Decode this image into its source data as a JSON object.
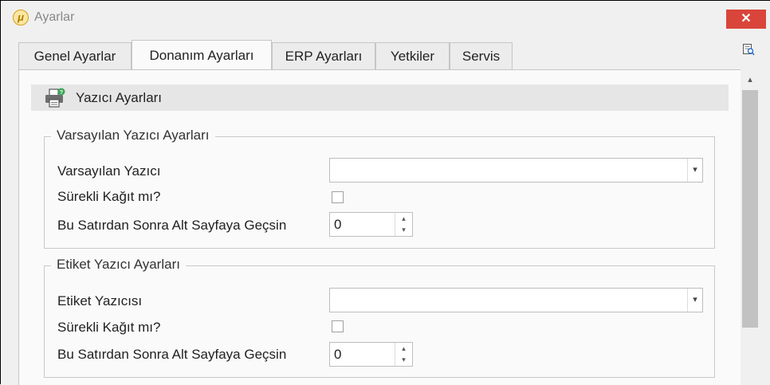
{
  "window": {
    "title": "Ayarlar",
    "app_icon_glyph": "μ",
    "close_glyph": "✕",
    "close_color": "#d9453b"
  },
  "tabs": [
    {
      "label": "Genel Ayarlar",
      "active": false
    },
    {
      "label": "Donanım Ayarları",
      "active": true
    },
    {
      "label": "ERP Ayarları",
      "active": false
    },
    {
      "label": "Yetkiler",
      "active": false
    },
    {
      "label": "Servis",
      "active": false
    }
  ],
  "section": {
    "title": "Yazıcı Ayarları",
    "icon": "printer-icon"
  },
  "default_printer_group": {
    "legend": "Varsayılan Yazıcı Ayarları",
    "printer_label": "Varsayılan Yazıcı",
    "printer_value": "",
    "continuous_paper_label": "Sürekli Kağıt mı?",
    "continuous_paper_checked": false,
    "next_page_row_label": "Bu Satırdan Sonra Alt Sayfaya Geçsin",
    "next_page_row_value": "0"
  },
  "label_printer_group": {
    "legend": "Etiket Yazıcı Ayarları",
    "printer_label": "Etiket Yazıcısı",
    "printer_value": "",
    "continuous_paper_label": "Sürekli Kağıt mı?",
    "continuous_paper_checked": false,
    "next_page_row_label": "Bu Satırdan Sonra Alt Sayfaya Geçsin",
    "next_page_row_value": "0"
  },
  "glyphs": {
    "dropdown": "▾",
    "spin_up": "▴",
    "spin_down": "▾",
    "scroll_up": "▴"
  }
}
